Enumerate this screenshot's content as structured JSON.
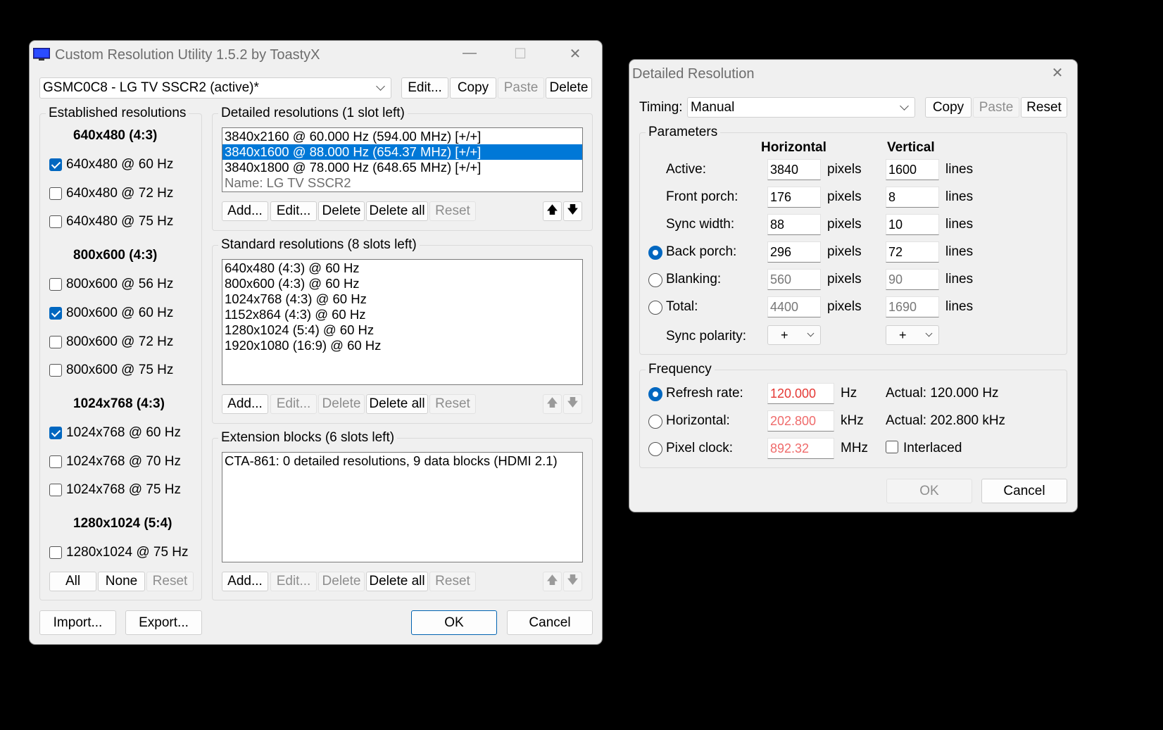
{
  "main": {
    "title": "Custom Resolution Utility 1.5.2 by ToastyX",
    "titlebar": {
      "minimize": "—",
      "maximize": "☐",
      "close": "✕"
    },
    "monitor_select": "GSMC0C8 - LG TV SSCR2 (active)*",
    "top_buttons": {
      "edit": "Edit...",
      "copy": "Copy",
      "paste": "Paste",
      "delete": "Delete"
    },
    "established": {
      "label": "Established resolutions",
      "groups": [
        {
          "heading": "640x480 (4:3)",
          "items": [
            {
              "label": "640x480 @ 60 Hz",
              "checked": true
            },
            {
              "label": "640x480 @ 72 Hz",
              "checked": false
            },
            {
              "label": "640x480 @ 75 Hz",
              "checked": false
            }
          ]
        },
        {
          "heading": "800x600 (4:3)",
          "items": [
            {
              "label": "800x600 @ 56 Hz",
              "checked": false
            },
            {
              "label": "800x600 @ 60 Hz",
              "checked": true
            },
            {
              "label": "800x600 @ 72 Hz",
              "checked": false
            },
            {
              "label": "800x600 @ 75 Hz",
              "checked": false
            }
          ]
        },
        {
          "heading": "1024x768 (4:3)",
          "items": [
            {
              "label": "1024x768 @ 60 Hz",
              "checked": true
            },
            {
              "label": "1024x768 @ 70 Hz",
              "checked": false
            },
            {
              "label": "1024x768 @ 75 Hz",
              "checked": false
            }
          ]
        },
        {
          "heading": "1280x1024 (5:4)",
          "items": [
            {
              "label": "1280x1024 @ 75 Hz",
              "checked": false
            }
          ]
        }
      ],
      "buttons": {
        "all": "All",
        "none": "None",
        "reset": "Reset"
      }
    },
    "detailed": {
      "label": "Detailed resolutions (1 slot left)",
      "items": [
        {
          "text": "3840x2160 @ 60.000 Hz (594.00 MHz) [+/+]",
          "state": "normal"
        },
        {
          "text": "3840x1600 @ 88.000 Hz (654.37 MHz) [+/+]",
          "state": "selected"
        },
        {
          "text": "3840x1800 @ 78.000 Hz (648.65 MHz) [+/+]",
          "state": "normal"
        },
        {
          "text": "Name: LG TV SSCR2",
          "state": "gray"
        }
      ],
      "buttons": {
        "add": "Add...",
        "edit": "Edit...",
        "delete": "Delete",
        "delete_all": "Delete all",
        "reset": "Reset",
        "up": "🡅",
        "down": "🡇"
      }
    },
    "standard": {
      "label": "Standard resolutions (8 slots left)",
      "items": [
        "640x480 (4:3) @ 60 Hz",
        "800x600 (4:3) @ 60 Hz",
        "1024x768 (4:3) @ 60 Hz",
        "1152x864 (4:3) @ 60 Hz",
        "1280x1024 (5:4) @ 60 Hz",
        "1920x1080 (16:9) @ 60 Hz"
      ],
      "buttons": {
        "add": "Add...",
        "edit": "Edit...",
        "delete": "Delete",
        "delete_all": "Delete all",
        "reset": "Reset",
        "up": "🡅",
        "down": "🡇"
      }
    },
    "extension": {
      "label": "Extension blocks (6 slots left)",
      "items": [
        "CTA-861: 0 detailed resolutions, 9 data blocks (HDMI 2.1)"
      ],
      "buttons": {
        "add": "Add...",
        "edit": "Edit...",
        "delete": "Delete",
        "delete_all": "Delete all",
        "reset": "Reset",
        "up": "🡅",
        "down": "🡇"
      }
    },
    "bottom_buttons": {
      "import": "Import...",
      "export": "Export...",
      "ok": "OK",
      "cancel": "Cancel"
    }
  },
  "detail": {
    "title": "Detailed Resolution",
    "close": "✕",
    "timing_label": "Timing:",
    "timing_value": "Manual",
    "buttons": {
      "copy": "Copy",
      "paste": "Paste",
      "reset": "Reset"
    },
    "parameters": {
      "label": "Parameters",
      "col_h": "Horizontal",
      "col_v": "Vertical",
      "rows": [
        {
          "label": "Active:",
          "h": "3840",
          "h_unit": "pixels",
          "v": "1600",
          "v_unit": "lines",
          "radio": null,
          "editable": true
        },
        {
          "label": "Front porch:",
          "h": "176",
          "h_unit": "pixels",
          "v": "8",
          "v_unit": "lines",
          "radio": null,
          "editable": true
        },
        {
          "label": "Sync width:",
          "h": "88",
          "h_unit": "pixels",
          "v": "10",
          "v_unit": "lines",
          "radio": null,
          "editable": true
        },
        {
          "label": "Back porch:",
          "h": "296",
          "h_unit": "pixels",
          "v": "72",
          "v_unit": "lines",
          "radio": true,
          "editable": true
        },
        {
          "label": "Blanking:",
          "h": "560",
          "h_unit": "pixels",
          "v": "90",
          "v_unit": "lines",
          "radio": false,
          "editable": false
        },
        {
          "label": "Total:",
          "h": "4400",
          "h_unit": "pixels",
          "v": "1690",
          "v_unit": "lines",
          "radio": false,
          "editable": false
        }
      ],
      "sync_polarity_label": "Sync polarity:",
      "sync_h": "+",
      "sync_v": "+"
    },
    "frequency": {
      "label": "Frequency",
      "rows": [
        {
          "label": "Refresh rate:",
          "value": "120.000",
          "unit": "Hz",
          "actual": "Actual: 120.000 Hz",
          "selected": true
        },
        {
          "label": "Horizontal:",
          "value": "202.800",
          "unit": "kHz",
          "actual": "Actual: 202.800 kHz",
          "selected": false
        },
        {
          "label": "Pixel clock:",
          "value": "892.32",
          "unit": "MHz",
          "actual": null,
          "selected": false
        }
      ],
      "interlaced_label": "Interlaced",
      "interlaced_checked": false
    },
    "ok": "OK",
    "cancel": "Cancel"
  }
}
